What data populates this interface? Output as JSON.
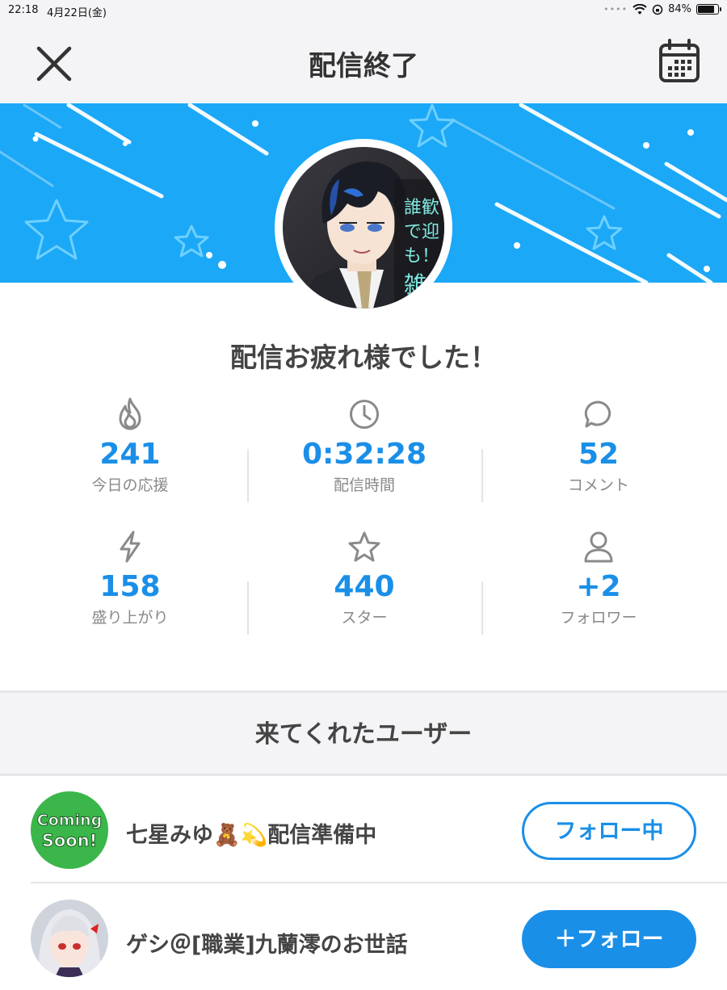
{
  "status_bar": {
    "time": "22:18",
    "date": "4月22日(金)",
    "battery": "84%",
    "battery_level": 0.84
  },
  "nav": {
    "title": "配信終了",
    "close_icon": "close-icon",
    "calendar_icon": "calendar-icon"
  },
  "avatar": {
    "overlay_text": [
      "誰歓",
      "で迎",
      "も！",
      "雑談"
    ]
  },
  "thanks_message": "配信お疲れ様でした！",
  "stats": [
    {
      "icon": "flame-icon",
      "value": "241",
      "label": "今日の応援"
    },
    {
      "icon": "clock-icon",
      "value": "0:32:28",
      "label": "配信時間"
    },
    {
      "icon": "comment-icon",
      "value": "52",
      "label": "コメント"
    },
    {
      "icon": "lightning-icon",
      "value": "158",
      "label": "盛り上がり"
    },
    {
      "icon": "star-icon",
      "value": "440",
      "label": "スター"
    },
    {
      "icon": "person-icon",
      "value": "+2",
      "label": "フォロワー"
    }
  ],
  "section": {
    "title": "来てくれたユーザー"
  },
  "users": [
    {
      "name": "七星みゆ🧸💫配信準備中",
      "avatar_text": [
        "Coming",
        "Soon!"
      ],
      "button": "フォロー中",
      "state": "following"
    },
    {
      "name": "ゲシ＠[職業]九蘭澪のお世話",
      "button": "＋フォロー",
      "state": "follow"
    }
  ],
  "colors": {
    "accent": "#1a8fe8",
    "banner": "#1ba8f7",
    "background": "#f4f4f6"
  }
}
